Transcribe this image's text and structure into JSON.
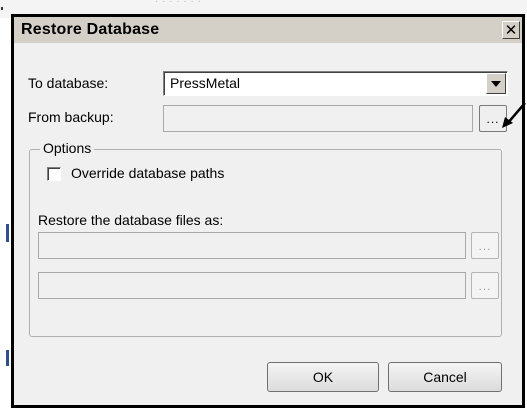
{
  "dialog": {
    "title": "Restore Database",
    "close_glyph": "✕"
  },
  "form": {
    "to_database_label": "To database:",
    "to_database_value": "PressMetal",
    "from_backup_label": "From backup:",
    "from_backup_value": "",
    "browse_label": "..."
  },
  "options": {
    "group_label": "Options",
    "override_paths_label": "Override database paths",
    "override_paths_checked": false,
    "restore_files_label": "Restore the database files as:",
    "file_rows": [
      {
        "value": "",
        "browse_label": "..."
      },
      {
        "value": "",
        "browse_label": "..."
      }
    ]
  },
  "buttons": {
    "ok_label": "OK",
    "cancel_label": "Cancel"
  },
  "background": {
    "ghost_text": "· · · · · · ·"
  },
  "icons": {
    "close": "close-icon",
    "dropdown": "chevron-down-icon",
    "annotation": "arrow-icon"
  }
}
